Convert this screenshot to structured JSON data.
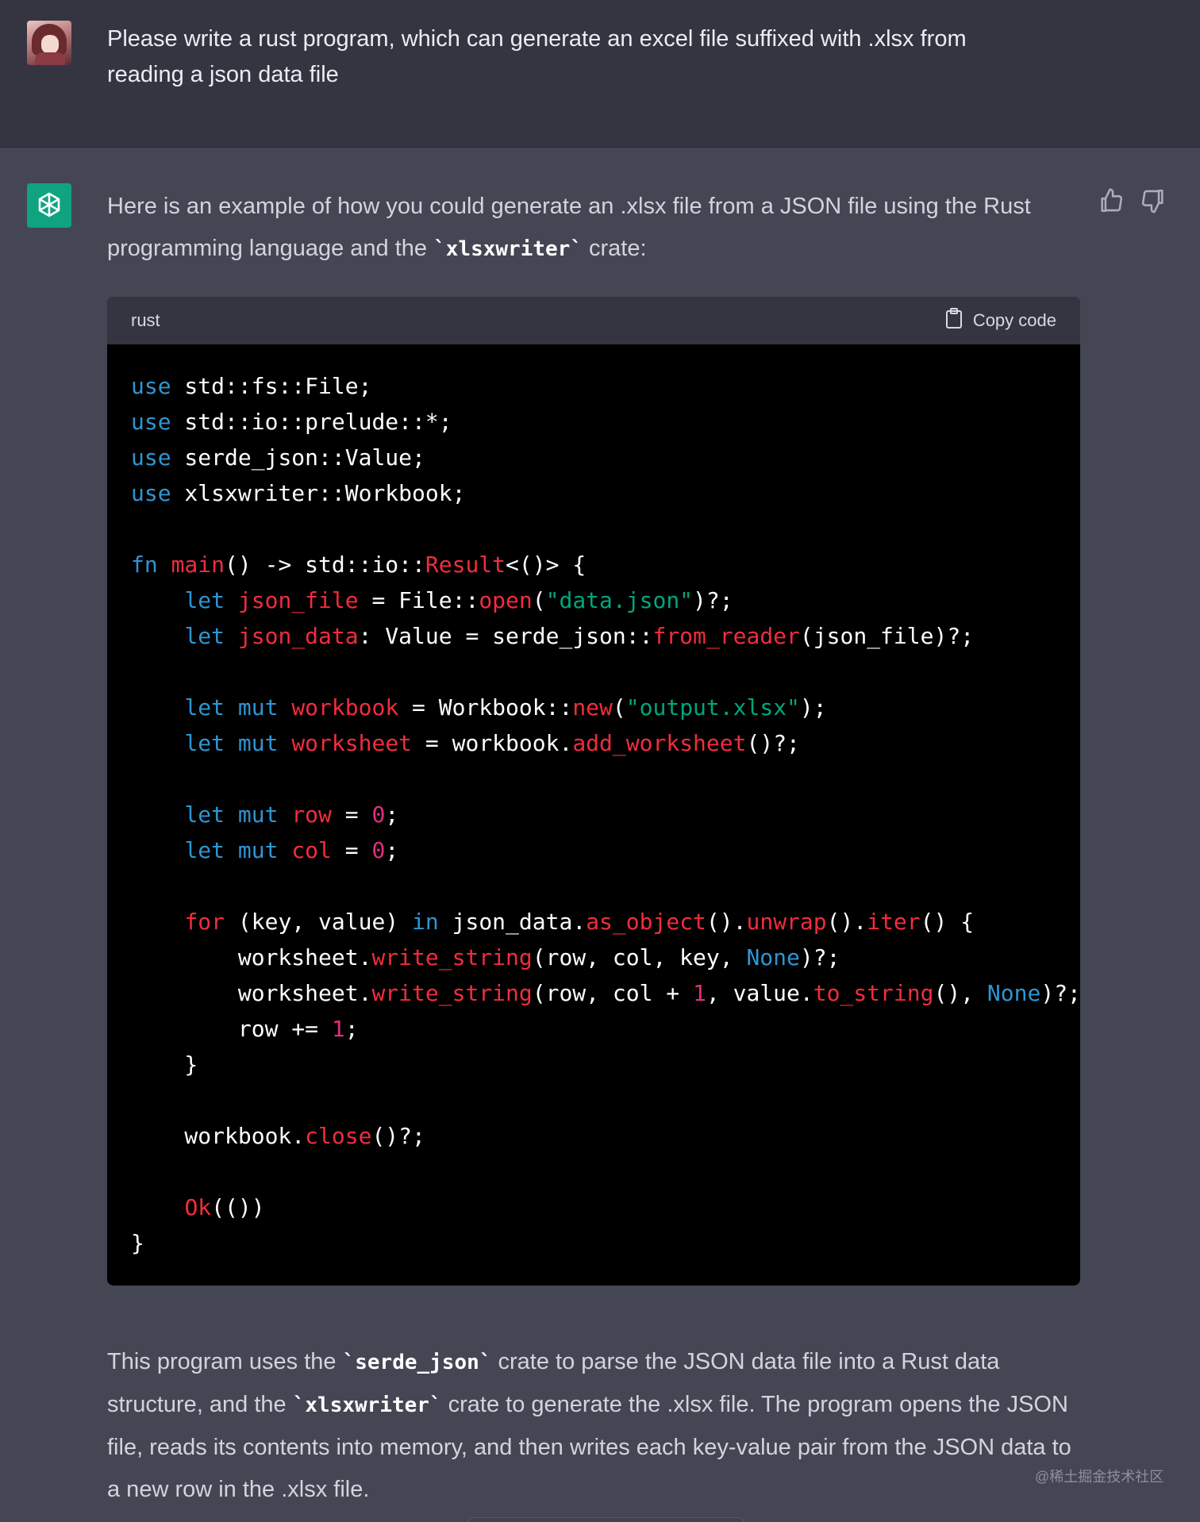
{
  "user_message": {
    "text": "Please write a rust program, which can generate an excel file suffixed with .xlsx from reading a json data file"
  },
  "assistant": {
    "intro_before": "Here is an example of how you could generate an .xlsx file from a JSON file using the Rust programming language and the ",
    "intro_code": "`xlsxwriter`",
    "intro_after": " crate:",
    "code_block": {
      "language": "rust",
      "copy_label": "Copy code"
    },
    "outro": {
      "p1": "This program uses the ",
      "c1": "`serde_json`",
      "p2": " crate to parse the JSON data file into a Rust data structure, and the ",
      "c2": "`xlsxwriter`",
      "p3": " crate to generate the .xlsx file. The program opens the JSON file, reads its contents into memory, and then writes each key-value pair from the JSON data to a new row in the .xlsx file."
    }
  },
  "code_lines": [
    [
      [
        "kw",
        "use"
      ],
      [
        "t",
        " std::fs::File;"
      ]
    ],
    [
      [
        "kw",
        "use"
      ],
      [
        "t",
        " std::io::prelude::*;"
      ]
    ],
    [
      [
        "kw",
        "use"
      ],
      [
        "t",
        " serde_json::Value;"
      ]
    ],
    [
      [
        "kw",
        "use"
      ],
      [
        "t",
        " xlsxwriter::Workbook;"
      ]
    ],
    [],
    [
      [
        "kw",
        "fn"
      ],
      [
        "t",
        " "
      ],
      [
        "fn",
        "main"
      ],
      [
        "t",
        "() -> std::io::"
      ],
      [
        "fn",
        "Result"
      ],
      [
        "t",
        "<()> {"
      ]
    ],
    [
      [
        "t",
        "    "
      ],
      [
        "kw",
        "let"
      ],
      [
        "t",
        " "
      ],
      [
        "fn",
        "json_file"
      ],
      [
        "t",
        " = File::"
      ],
      [
        "fn",
        "open"
      ],
      [
        "t",
        "("
      ],
      [
        "str",
        "\"data.json\""
      ],
      [
        "t",
        ")?;"
      ]
    ],
    [
      [
        "t",
        "    "
      ],
      [
        "kw",
        "let"
      ],
      [
        "t",
        " "
      ],
      [
        "fn",
        "json_data"
      ],
      [
        "t",
        ": Value = serde_json::"
      ],
      [
        "fn",
        "from_reader"
      ],
      [
        "t",
        "(json_file)?;"
      ]
    ],
    [],
    [
      [
        "t",
        "    "
      ],
      [
        "kw",
        "let"
      ],
      [
        "t",
        " "
      ],
      [
        "kw",
        "mut"
      ],
      [
        "t",
        " "
      ],
      [
        "fn",
        "workbook"
      ],
      [
        "t",
        " = Workbook::"
      ],
      [
        "fn",
        "new"
      ],
      [
        "t",
        "("
      ],
      [
        "str",
        "\"output.xlsx\""
      ],
      [
        "t",
        ");"
      ]
    ],
    [
      [
        "t",
        "    "
      ],
      [
        "kw",
        "let"
      ],
      [
        "t",
        " "
      ],
      [
        "kw",
        "mut"
      ],
      [
        "t",
        " "
      ],
      [
        "fn",
        "worksheet"
      ],
      [
        "t",
        " = workbook."
      ],
      [
        "fn",
        "add_worksheet"
      ],
      [
        "t",
        "()?;"
      ]
    ],
    [],
    [
      [
        "t",
        "    "
      ],
      [
        "kw",
        "let"
      ],
      [
        "t",
        " "
      ],
      [
        "kw",
        "mut"
      ],
      [
        "t",
        " "
      ],
      [
        "fn",
        "row"
      ],
      [
        "t",
        " = "
      ],
      [
        "num",
        "0"
      ],
      [
        "t",
        ";"
      ]
    ],
    [
      [
        "t",
        "    "
      ],
      [
        "kw",
        "let"
      ],
      [
        "t",
        " "
      ],
      [
        "kw",
        "mut"
      ],
      [
        "t",
        " "
      ],
      [
        "fn",
        "col"
      ],
      [
        "t",
        " = "
      ],
      [
        "num",
        "0"
      ],
      [
        "t",
        ";"
      ]
    ],
    [],
    [
      [
        "t",
        "    "
      ],
      [
        "fn",
        "for"
      ],
      [
        "t",
        " (key, value) "
      ],
      [
        "kw",
        "in"
      ],
      [
        "t",
        " json_data."
      ],
      [
        "fn",
        "as_object"
      ],
      [
        "t",
        "()."
      ],
      [
        "fn",
        "unwrap"
      ],
      [
        "t",
        "()."
      ],
      [
        "fn",
        "iter"
      ],
      [
        "t",
        "() {"
      ]
    ],
    [
      [
        "t",
        "        worksheet."
      ],
      [
        "fn",
        "write_string"
      ],
      [
        "t",
        "(row, col, key, "
      ],
      [
        "kw",
        "None"
      ],
      [
        "t",
        ")?;"
      ]
    ],
    [
      [
        "t",
        "        worksheet."
      ],
      [
        "fn",
        "write_string"
      ],
      [
        "t",
        "(row, col + "
      ],
      [
        "num",
        "1"
      ],
      [
        "t",
        ", value."
      ],
      [
        "fn",
        "to_string"
      ],
      [
        "t",
        "(), "
      ],
      [
        "kw",
        "None"
      ],
      [
        "t",
        ")?;"
      ]
    ],
    [
      [
        "t",
        "        row += "
      ],
      [
        "num",
        "1"
      ],
      [
        "t",
        ";"
      ]
    ],
    [
      [
        "t",
        "    }"
      ]
    ],
    [],
    [
      [
        "t",
        "    workbook."
      ],
      [
        "fn",
        "close"
      ],
      [
        "t",
        "()?;"
      ]
    ],
    [],
    [
      [
        "t",
        "    "
      ],
      [
        "fn",
        "Ok"
      ],
      [
        "t",
        "(())"
      ]
    ],
    [
      [
        "t",
        "}"
      ]
    ]
  ],
  "watermark": "@稀土掘金技术社区",
  "colors": {
    "user_bg": "#343541",
    "assistant_bg": "#444654",
    "code_bg": "#000000",
    "keyword": "#2e95d3",
    "function": "#f22c3d",
    "string": "#00a67d",
    "number": "#df3079",
    "brand": "#10a37f"
  },
  "icons": [
    "openai-logo-icon",
    "thumbs-up-icon",
    "thumbs-down-icon",
    "clipboard-icon"
  ]
}
